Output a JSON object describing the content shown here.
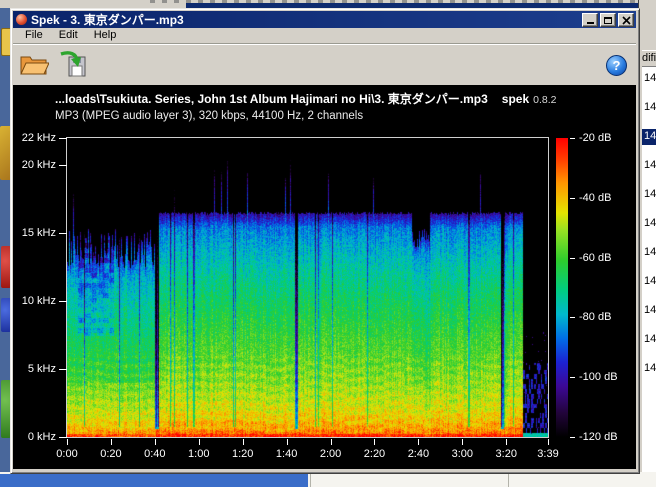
{
  "window": {
    "title": "Spek - 3. 東京ダンパー.mp3",
    "menu": [
      "File",
      "Edit",
      "Help"
    ],
    "controls": [
      "minimize",
      "maximize",
      "close"
    ]
  },
  "toolbar": {
    "icons": [
      "open-folder-icon",
      "save-icon",
      "help-icon"
    ],
    "help_glyph": "?"
  },
  "spek": {
    "header_line": "...loads\\Tsukiuta. Series, John 1st Album Hajimari no Hi\\3. 東京ダンパー.mp3",
    "app_name": "spek",
    "app_version": "0.8.2",
    "file_info": "MP3 (MPEG audio layer 3), 320 kbps, 44100 Hz, 2 channels"
  },
  "chart_data": {
    "type": "heatmap",
    "title": "...loads\\Tsukiuta. Series, John 1st Album Hajimari no Hi\\3. 東京ダンパー.mp3",
    "subtitle": "MP3 (MPEG audio layer 3), 320 kbps, 44100 Hz, 2 channels",
    "duration_sec": 219,
    "freq_max_khz": 22,
    "db_range": [
      -120,
      -20
    ],
    "mp3_cutoff_khz": 16.6,
    "x_ticks": [
      {
        "sec": 0,
        "label": "0:00"
      },
      {
        "sec": 20,
        "label": "0:20"
      },
      {
        "sec": 40,
        "label": "0:40"
      },
      {
        "sec": 60,
        "label": "1:00"
      },
      {
        "sec": 80,
        "label": "1:20"
      },
      {
        "sec": 100,
        "label": "1:40"
      },
      {
        "sec": 120,
        "label": "2:00"
      },
      {
        "sec": 140,
        "label": "2:20"
      },
      {
        "sec": 160,
        "label": "2:40"
      },
      {
        "sec": 180,
        "label": "3:00"
      },
      {
        "sec": 200,
        "label": "3:20"
      },
      {
        "sec": 219,
        "label": "3:39"
      }
    ],
    "y_ticks": [
      {
        "khz": 22,
        "label": "22 kHz"
      },
      {
        "khz": 20,
        "label": "20 kHz"
      },
      {
        "khz": 15,
        "label": "15 kHz"
      },
      {
        "khz": 10,
        "label": "10 kHz"
      },
      {
        "khz": 5,
        "label": "5 kHz"
      },
      {
        "khz": 0,
        "label": "0 kHz"
      }
    ],
    "db_ticks": [
      {
        "db": -20,
        "label": "-20 dB"
      },
      {
        "db": -40,
        "label": "-40 dB"
      },
      {
        "db": -60,
        "label": "-60 dB"
      },
      {
        "db": -80,
        "label": "-80 dB"
      },
      {
        "db": -100,
        "label": "-100 dB"
      },
      {
        "db": -120,
        "label": "-120 dB"
      }
    ],
    "palette": [
      [
        -120,
        "#000000"
      ],
      [
        -112,
        "#22043a"
      ],
      [
        -103,
        "#3c0896"
      ],
      [
        -95,
        "#1c22d2"
      ],
      [
        -87,
        "#006ee6"
      ],
      [
        -79,
        "#00b9cd"
      ],
      [
        -71,
        "#00cd82"
      ],
      [
        -61,
        "#2dcd2d"
      ],
      [
        -51,
        "#96e123"
      ],
      [
        -45,
        "#e4e400"
      ],
      [
        -35,
        "#ff9600"
      ],
      [
        -27,
        "#ff3c00"
      ],
      [
        -20,
        "#ff0000"
      ]
    ],
    "sections": [
      {
        "start": 0,
        "end": 40.5,
        "type": "intro",
        "top_khz": 15.0,
        "attenuation_db": 7
      },
      {
        "start": 40.5,
        "end": 157,
        "type": "main",
        "top_khz": 16.6,
        "attenuation_db": 0
      },
      {
        "start": 157,
        "end": 165,
        "type": "bridge",
        "top_khz": 14.8,
        "attenuation_db": 5
      },
      {
        "start": 165,
        "end": 207.5,
        "type": "main",
        "top_khz": 16.6,
        "attenuation_db": 0
      },
      {
        "start": 207.5,
        "end": 219,
        "type": "outro-fade",
        "top_khz": 5.5,
        "attenuation_db": 40
      }
    ],
    "silence_gaps_sec": [
      [
        40.0,
        41.6
      ],
      [
        103.6,
        104.8
      ],
      [
        197.5,
        198.6
      ]
    ]
  },
  "background": {
    "list_header_fragment": "difie",
    "list_rows": [
      "14",
      "14",
      "14",
      "14",
      "14",
      "14",
      "14",
      "14",
      "14",
      "14",
      "14"
    ],
    "selected_row_index": 2,
    "selection_color": "#0a246a"
  }
}
